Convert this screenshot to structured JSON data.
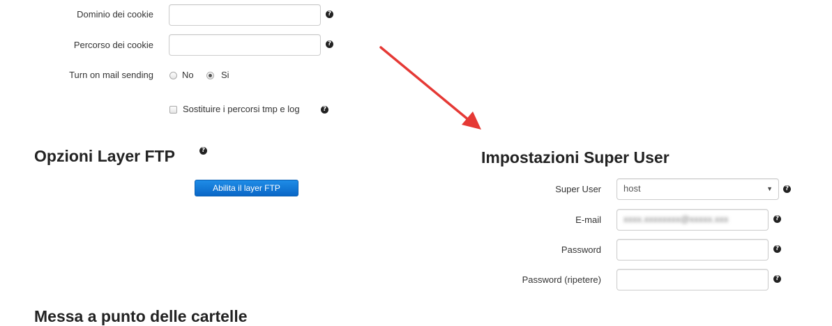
{
  "general": {
    "cookie_domain_label": "Dominio dei cookie",
    "cookie_domain_value": "",
    "cookie_path_label": "Percorso dei cookie",
    "cookie_path_value": "",
    "mail_label": "Turn on mail sending",
    "mail_options": [
      "No",
      "Si"
    ],
    "mail_selected": "Si",
    "replace_paths_label": "Sostituire i percorsi tmp e log",
    "replace_paths_checked": false
  },
  "ftp": {
    "title": "Opzioni Layer FTP",
    "enable_button": "Abilita il layer FTP"
  },
  "super_user": {
    "title": "Impostazioni Super User",
    "user_label": "Super User",
    "user_value": "host",
    "email_label": "E-mail",
    "email_value": "xxxx.xxxxxxxx@xxxxx.xxx",
    "password_label": "Password",
    "password_value": "",
    "password_repeat_label": "Password (ripetere)",
    "password_repeat_value": ""
  },
  "next_section": {
    "title": "Messa a punto delle cartelle"
  },
  "icons": {
    "help": "question-circle-icon",
    "annotation": "red-arrow"
  },
  "colors": {
    "button_blue": "#0a67c7",
    "arrow_red": "#e53935"
  }
}
